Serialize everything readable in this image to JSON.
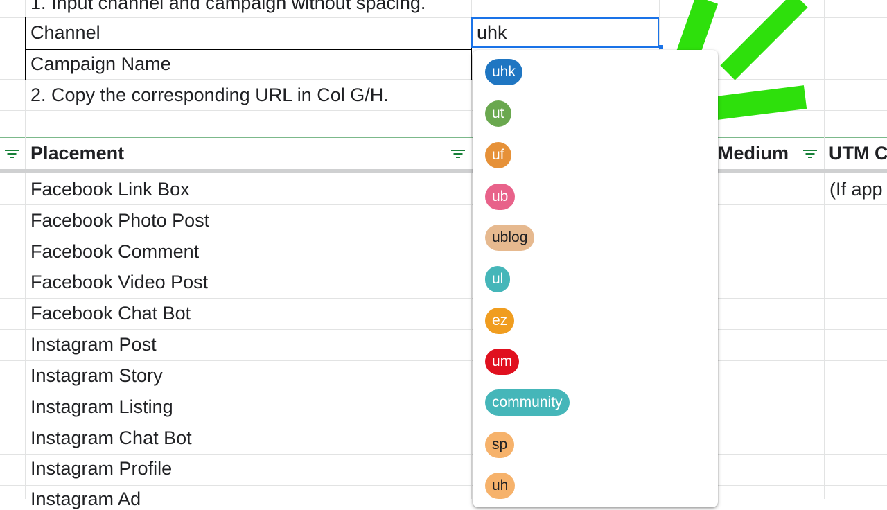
{
  "instructions": {
    "line1": "1. Input channel and campaign without spacing.",
    "line2": "2. Copy the corresponding URL in Col G/H."
  },
  "form": {
    "channel_label": "Channel",
    "campaign_label": "Campaign Name",
    "channel_value": "uhk"
  },
  "headers": {
    "placement": "Placement",
    "medium": "Medium",
    "utm": "UTM C"
  },
  "utm_note": "(If app",
  "placements": [
    "Facebook Link Box",
    "Facebook Photo Post",
    "Facebook Comment",
    "Facebook Video Post",
    "Facebook Chat Bot",
    "Instagram Post",
    "Instagram Story",
    "Instagram Listing",
    "Instagram Chat Bot",
    "Instagram Profile",
    "Instagram Ad"
  ],
  "dropdown": {
    "options": [
      {
        "label": "uhk",
        "color": "#1f76c2",
        "text_color": "#ffffff"
      },
      {
        "label": "ut",
        "color": "#6aa84f",
        "text_color": "#ffffff"
      },
      {
        "label": "uf",
        "color": "#e69138",
        "text_color": "#ffffff"
      },
      {
        "label": "ub",
        "color": "#e8628a",
        "text_color": "#ffffff"
      },
      {
        "label": "ublog",
        "color": "#e6b98f",
        "text_color": "#202124"
      },
      {
        "label": "ul",
        "color": "#45b6b9",
        "text_color": "#ffffff"
      },
      {
        "label": "ez",
        "color": "#f09d1f",
        "text_color": "#ffffff"
      },
      {
        "label": "um",
        "color": "#e0101f",
        "text_color": "#ffffff"
      },
      {
        "label": "community",
        "color": "#45b6b9",
        "text_color": "#ffffff"
      },
      {
        "label": "sp",
        "color": "#f6b26b",
        "text_color": "#202124"
      },
      {
        "label": "uh",
        "color": "#f6b26b",
        "text_color": "#202124"
      }
    ]
  },
  "colors": {
    "accent_blue": "#1a73e8",
    "filter_green": "#188038",
    "annotation_green": "#2ee00c"
  }
}
